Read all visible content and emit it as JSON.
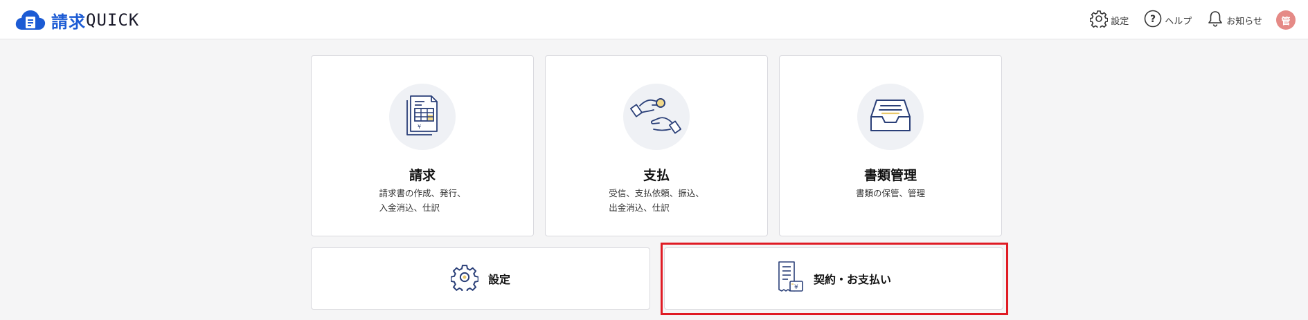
{
  "app": {
    "logo_kanji": "請求",
    "logo_latin": "QUICK"
  },
  "header_nav": {
    "settings_label": "設定",
    "help_label": "ヘルプ",
    "notifications_label": "お知らせ",
    "avatar_initial": "管"
  },
  "cards": [
    {
      "title": "請求",
      "desc_line1": "請求書の作成、発行、",
      "desc_line2": "入金消込、仕訳",
      "icon": "invoice-document-icon"
    },
    {
      "title": "支払",
      "desc_line1": "受信、支払依頼、振込、",
      "desc_line2": "出金消込、仕訳",
      "icon": "payment-hands-icon"
    },
    {
      "title": "書類管理",
      "desc_line1": "書類の保管、管理",
      "desc_line2": "",
      "icon": "document-tray-icon"
    }
  ],
  "bottom_cards": [
    {
      "label": "設定",
      "icon": "gear-icon"
    },
    {
      "label": "契約・お支払い",
      "icon": "contract-receipt-icon"
    }
  ],
  "colors": {
    "brand_blue": "#1c5bd4",
    "icon_navy": "#2a3f78",
    "highlight_red": "#e01b24",
    "avatar_bg": "#e58a86"
  }
}
